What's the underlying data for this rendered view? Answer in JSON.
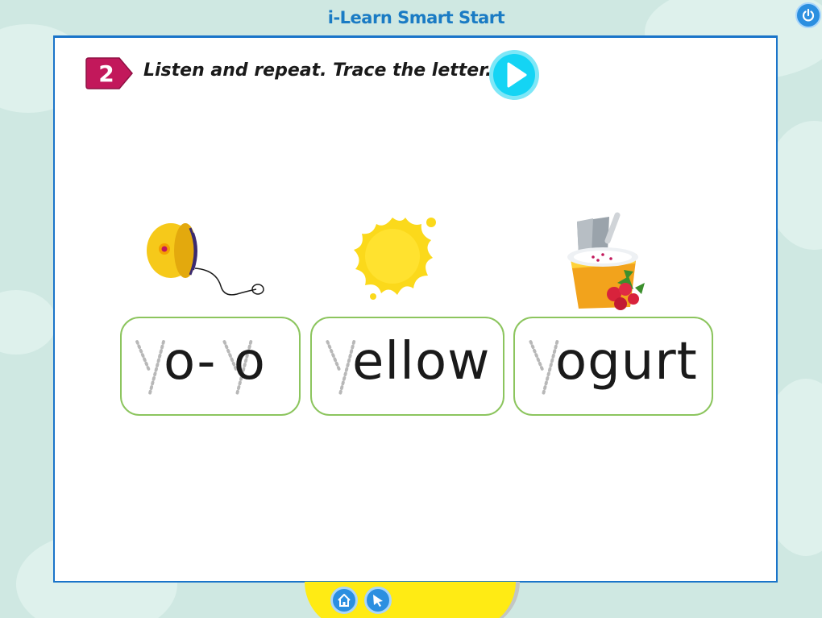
{
  "header": {
    "title": "i-Learn Smart Start",
    "power_icon": "power-icon"
  },
  "activity": {
    "step_number": "2",
    "instruction": "Listen and repeat. Trace the letter.",
    "play_icon": "play-icon"
  },
  "words": [
    {
      "picture": "yo-yo-picture",
      "traced_letter": "y",
      "text": "o- o",
      "second_traced_letter": "y"
    },
    {
      "picture": "sun-picture",
      "traced_letter": "y",
      "text": "ellow"
    },
    {
      "picture": "yogurt-picture",
      "traced_letter": "y",
      "text": "ogurt"
    }
  ],
  "footer": {
    "home_icon": "home-icon",
    "cursor_icon": "cursor-icon"
  },
  "colors": {
    "accent_blue": "#1a74c9",
    "badge_magenta": "#c2185b",
    "card_border_green": "#8cc55e",
    "footer_yellow": "#ffeb14",
    "play_cyan": "#14d4f4"
  }
}
